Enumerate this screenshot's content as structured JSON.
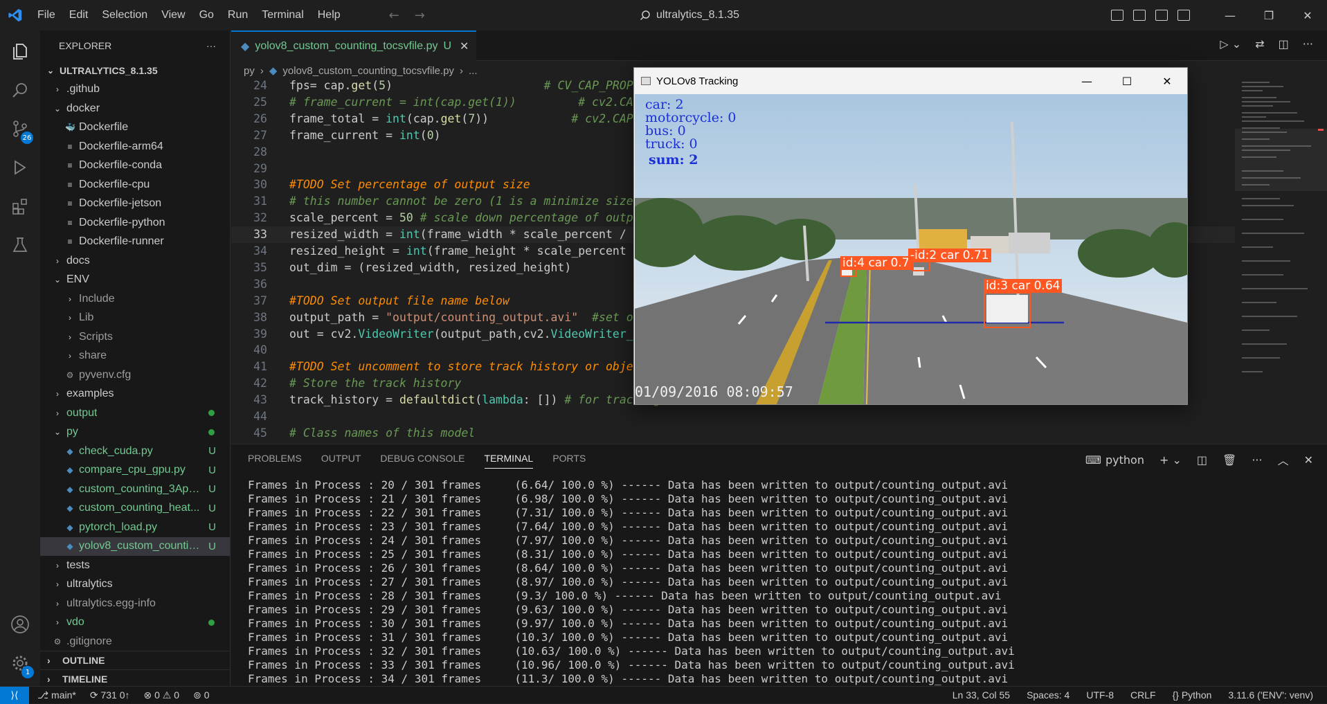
{
  "titlebar": {
    "menu": [
      "File",
      "Edit",
      "Selection",
      "View",
      "Go",
      "Run",
      "Terminal",
      "Help"
    ],
    "search_text": "ultralytics_8.1.35"
  },
  "activity": {
    "scm_badge": "26",
    "accounts_badge": "1"
  },
  "sidebar": {
    "title": "EXPLORER",
    "root": "ULTRALYTICS_8.1.35",
    "items": [
      {
        "label": ".github",
        "depth": 1,
        "chev": "›",
        "color": "#cccccc"
      },
      {
        "label": "docker",
        "depth": 1,
        "chev": "⌄",
        "color": "#cccccc"
      },
      {
        "label": "Dockerfile",
        "depth": 2,
        "chev": "",
        "color": "#cccccc",
        "icon": "docker"
      },
      {
        "label": "Dockerfile-arm64",
        "depth": 2,
        "chev": "",
        "color": "#cccccc",
        "icon": "lines"
      },
      {
        "label": "Dockerfile-conda",
        "depth": 2,
        "chev": "",
        "color": "#cccccc",
        "icon": "lines"
      },
      {
        "label": "Dockerfile-cpu",
        "depth": 2,
        "chev": "",
        "color": "#cccccc",
        "icon": "lines"
      },
      {
        "label": "Dockerfile-jetson",
        "depth": 2,
        "chev": "",
        "color": "#cccccc",
        "icon": "lines"
      },
      {
        "label": "Dockerfile-python",
        "depth": 2,
        "chev": "",
        "color": "#cccccc",
        "icon": "lines"
      },
      {
        "label": "Dockerfile-runner",
        "depth": 2,
        "chev": "",
        "color": "#cccccc",
        "icon": "lines"
      },
      {
        "label": "docs",
        "depth": 1,
        "chev": "›",
        "color": "#cccccc"
      },
      {
        "label": "ENV",
        "depth": 1,
        "chev": "⌄",
        "color": "#cccccc"
      },
      {
        "label": "Include",
        "depth": 2,
        "chev": "›",
        "color": "#9d9d9d"
      },
      {
        "label": "Lib",
        "depth": 2,
        "chev": "›",
        "color": "#9d9d9d"
      },
      {
        "label": "Scripts",
        "depth": 2,
        "chev": "›",
        "color": "#9d9d9d"
      },
      {
        "label": "share",
        "depth": 2,
        "chev": "›",
        "color": "#9d9d9d"
      },
      {
        "label": "pyvenv.cfg",
        "depth": 2,
        "chev": "",
        "color": "#9d9d9d",
        "icon": "gear"
      },
      {
        "label": "examples",
        "depth": 1,
        "chev": "›",
        "color": "#cccccc"
      },
      {
        "label": "output",
        "depth": 1,
        "chev": "›",
        "color": "#73c991",
        "dot": true
      },
      {
        "label": "py",
        "depth": 1,
        "chev": "⌄",
        "color": "#73c991",
        "dot": true
      },
      {
        "label": "check_cuda.py",
        "depth": 2,
        "chev": "",
        "color": "#73c991",
        "icon": "py",
        "status": "U"
      },
      {
        "label": "compare_cpu_gpu.py",
        "depth": 2,
        "chev": "",
        "color": "#73c991",
        "icon": "py",
        "status": "U"
      },
      {
        "label": "custom_counting_3App...",
        "depth": 2,
        "chev": "",
        "color": "#73c991",
        "icon": "py",
        "status": "U"
      },
      {
        "label": "custom_counting_heat...",
        "depth": 2,
        "chev": "",
        "color": "#73c991",
        "icon": "py",
        "status": "U"
      },
      {
        "label": "pytorch_load.py",
        "depth": 2,
        "chev": "",
        "color": "#73c991",
        "icon": "py",
        "status": "U"
      },
      {
        "label": "yolov8_custom_countin...",
        "depth": 2,
        "chev": "",
        "color": "#73c991",
        "icon": "py",
        "status": "U",
        "selected": true
      },
      {
        "label": "tests",
        "depth": 1,
        "chev": "›",
        "color": "#cccccc"
      },
      {
        "label": "ultralytics",
        "depth": 1,
        "chev": "›",
        "color": "#cccccc"
      },
      {
        "label": "ultralytics.egg-info",
        "depth": 1,
        "chev": "›",
        "color": "#9d9d9d"
      },
      {
        "label": "vdo",
        "depth": 1,
        "chev": "›",
        "color": "#73c991",
        "dot": true
      },
      {
        "label": ".gitignore",
        "depth": 1,
        "chev": "",
        "color": "#9d9d9d",
        "icon": "gear"
      }
    ],
    "outline": "OUTLINE",
    "timeline": "TIMELINE"
  },
  "tab": {
    "filename": "yolov8_custom_counting_tocsvfile.py",
    "status": "U"
  },
  "breadcrumb": {
    "folder": "py",
    "file": "yolov8_custom_counting_tocsvfile.py",
    "more": "..."
  },
  "editor": {
    "lines": [
      {
        "n": "24",
        "html": "fps= cap.<span class='fn'>get</span>(<span class='num'>5</span>)                      <span class='cmt'># CV_CAP_PROP_FPS</span>"
      },
      {
        "n": "25",
        "html": "<span class='cmt'># frame_current = int(cap.get(1))         # cv2.CAP_PROP_POS_FRAMES</span>"
      },
      {
        "n": "26",
        "html": "frame_total = <span class='kw'>int</span>(cap.<span class='fn'>get</span>(<span class='num'>7</span>))            <span class='cmt'># cv2.CAP_PROP_FRAME_COUNT</span>"
      },
      {
        "n": "27",
        "html": "frame_current = <span class='kw'>int</span>(<span class='num'>0</span>)"
      },
      {
        "n": "28",
        "html": ""
      },
      {
        "n": "29",
        "html": ""
      },
      {
        "n": "30",
        "html": "<span class='todo'>#TODO Set percentage of output size</span>"
      },
      {
        "n": "31",
        "html": "<span class='cmt'># this number cannot be zero (1 is a minimize size of output video)</span>"
      },
      {
        "n": "32",
        "html": "scale_percent = <span class='num'>50</span> <span class='cmt'># scale down percentage of output video by using resize method                         g metho</span>"
      },
      {
        "n": "33",
        "html": "resized_width = <span class='kw'>int</span>(frame_width * scale_percent / <span class='num'>100</span>)",
        "cur": true
      },
      {
        "n": "34",
        "html": "resized_height = <span class='kw'>int</span>(frame_height * scale_percent / <span class='num'>100</span>)"
      },
      {
        "n": "35",
        "html": "out_dim = (resized_width, resized_height)"
      },
      {
        "n": "36",
        "html": ""
      },
      {
        "n": "37",
        "html": "<span class='todo'>#TODO Set output file name below</span>"
      },
      {
        "n": "38",
        "html": "output_path = <span class='str'>\"output/counting_output.avi\"</span>  <span class='cmt'>#set output</span>"
      },
      {
        "n": "39",
        "html": "out = cv2.<span class='kw'>VideoWriter</span>(output_path,cv2.<span class='kw'>VideoWriter_fourcc</span>"
      },
      {
        "n": "40",
        "html": ""
      },
      {
        "n": "41",
        "html": "<span class='todo'>#TODO Set uncomment to store track history or object</span>"
      },
      {
        "n": "42",
        "html": "<span class='cmt'># Store the track history</span>"
      },
      {
        "n": "43",
        "html": "track_history = <span class='fn'>defaultdict</span>(<span class='kw'>lambda</span>: []) <span class='cmt'># for tracking</span>"
      },
      {
        "n": "44",
        "html": ""
      },
      {
        "n": "45",
        "html": "<span class='cmt'># Class names of this model</span>"
      }
    ]
  },
  "panel": {
    "tabs": [
      "PROBLEMS",
      "OUTPUT",
      "DEBUG CONSOLE",
      "TERMINAL",
      "PORTS"
    ],
    "active_tab": "TERMINAL",
    "shell": "python",
    "lines": [
      "Frames in Process : 20 / 301 frames     (6.64/ 100.0 %) ------ Data has been written to output/counting_output.avi",
      "Frames in Process : 21 / 301 frames     (6.98/ 100.0 %) ------ Data has been written to output/counting_output.avi",
      "Frames in Process : 22 / 301 frames     (7.31/ 100.0 %) ------ Data has been written to output/counting_output.avi",
      "Frames in Process : 23 / 301 frames     (7.64/ 100.0 %) ------ Data has been written to output/counting_output.avi",
      "Frames in Process : 24 / 301 frames     (7.97/ 100.0 %) ------ Data has been written to output/counting_output.avi",
      "Frames in Process : 25 / 301 frames     (8.31/ 100.0 %) ------ Data has been written to output/counting_output.avi",
      "Frames in Process : 26 / 301 frames     (8.64/ 100.0 %) ------ Data has been written to output/counting_output.avi",
      "Frames in Process : 27 / 301 frames     (8.97/ 100.0 %) ------ Data has been written to output/counting_output.avi",
      "Frames in Process : 28 / 301 frames     (9.3/ 100.0 %) ------ Data has been written to output/counting_output.avi",
      "Frames in Process : 29 / 301 frames     (9.63/ 100.0 %) ------ Data has been written to output/counting_output.avi",
      "Frames in Process : 30 / 301 frames     (9.97/ 100.0 %) ------ Data has been written to output/counting_output.avi",
      "Frames in Process : 31 / 301 frames     (10.3/ 100.0 %) ------ Data has been written to output/counting_output.avi",
      "Frames in Process : 32 / 301 frames     (10.63/ 100.0 %) ------ Data has been written to output/counting_output.avi",
      "Frames in Process : 33 / 301 frames     (10.96/ 100.0 %) ------ Data has been written to output/counting_output.avi",
      "Frames in Process : 34 / 301 frames     (11.3/ 100.0 %) ------ Data has been written to output/counting_output.avi"
    ]
  },
  "yolo_window": {
    "title": "YOLOv8 Tracking",
    "counts": [
      "car: 2",
      "motorcycle: 0",
      "bus: 0",
      "truck: 0"
    ],
    "sum": "sum: 2",
    "timestamp": "01/09/2016 08:09:57",
    "detections": [
      "id:4 car 0.7",
      "-id:2 car 0.71",
      "id:3 car 0.64"
    ]
  },
  "statusbar": {
    "branch": "main*",
    "sync": "731 0↑",
    "errors": "0",
    "warnings": "0",
    "ports": "0",
    "position": "Ln 33, Col 55",
    "spaces": "Spaces: 4",
    "encoding": "UTF-8",
    "eol": "CRLF",
    "language": "Python",
    "interpreter": "3.11.6 ('ENV': venv)"
  },
  "colors": {
    "accent": "#0078d4",
    "git_untracked": "#73c991",
    "detection": "#ff5722",
    "count_text": "#1a2fd6"
  }
}
